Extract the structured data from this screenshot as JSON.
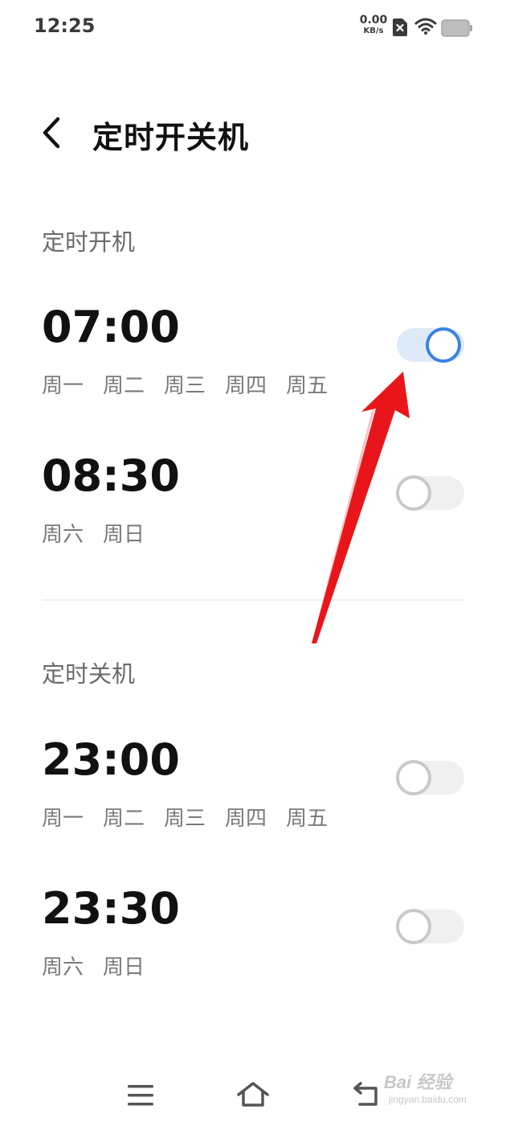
{
  "status_bar": {
    "time": "12:25",
    "net_speed_value": "0.00",
    "net_speed_unit": "KB/s",
    "icons": [
      "sim-card-x-icon",
      "wifi-icon",
      "battery-icon"
    ]
  },
  "header": {
    "title": "定时开关机",
    "back_icon": "chevron-left-icon"
  },
  "power_on": {
    "title": "定时开机",
    "items": [
      {
        "time": "07:00",
        "days": [
          "周一",
          "周二",
          "周三",
          "周四",
          "周五"
        ],
        "enabled": true
      },
      {
        "time": "08:30",
        "days": [
          "周六",
          "周日"
        ],
        "enabled": false
      }
    ]
  },
  "power_off": {
    "title": "定时关机",
    "items": [
      {
        "time": "23:00",
        "days": [
          "周一",
          "周二",
          "周三",
          "周四",
          "周五"
        ],
        "enabled": false
      },
      {
        "time": "23:30",
        "days": [
          "周六",
          "周日"
        ],
        "enabled": false
      }
    ]
  },
  "nav_bar": {
    "icons": [
      "menu-icon",
      "home-icon",
      "return-icon"
    ]
  },
  "watermark": {
    "brand": "Bai 经验",
    "url": "jingyan.baidu.com"
  },
  "colors": {
    "accent": "#3a82e4",
    "toggle_on_track": "#dfeaf9",
    "toggle_off_track": "#f0f0f0",
    "annotation_arrow": "#e8161b"
  }
}
